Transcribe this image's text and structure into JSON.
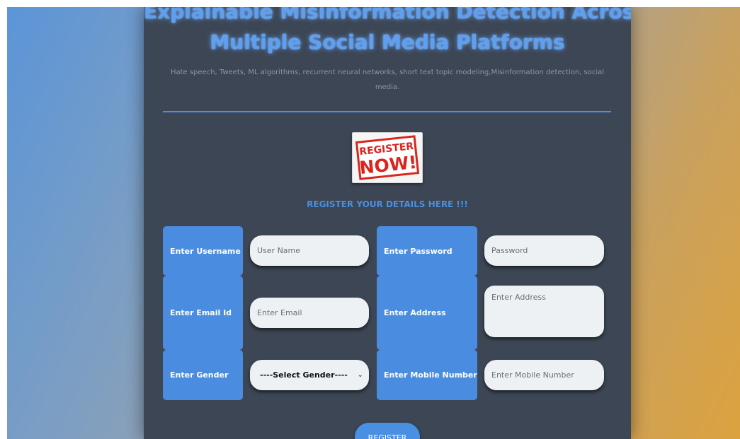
{
  "header": {
    "title_line1": "Explainable Misinformation Detection Across",
    "title_line2": "Multiple Social Media Platforms",
    "subtitle": "Hate speech, Tweets, ML algorithms, recurrent neural networks, short text topic modeling,Misinformation detection, social media."
  },
  "logo": {
    "top": "REGISTER",
    "bottom": "NOW!"
  },
  "form": {
    "heading": "REGISTER YOUR DETAILS HERE !!!",
    "username_label": "Enter Username",
    "username_placeholder": "User Name",
    "password_label": "Enter Password",
    "password_placeholder": "Password",
    "email_label": "Enter Email Id",
    "email_placeholder": "Enter Email",
    "address_label": "Enter Address",
    "address_placeholder": "Enter Address",
    "gender_label": "Enter Gender",
    "gender_selected": "----Select Gender----",
    "mobile_label": "Enter Mobile Number",
    "mobile_placeholder": "Enter Mobile Number",
    "submit_label": "REGISTER"
  },
  "colors": {
    "accent": "#4a90e2",
    "panel": "#3c4654",
    "logo_red": "#d9251d"
  }
}
